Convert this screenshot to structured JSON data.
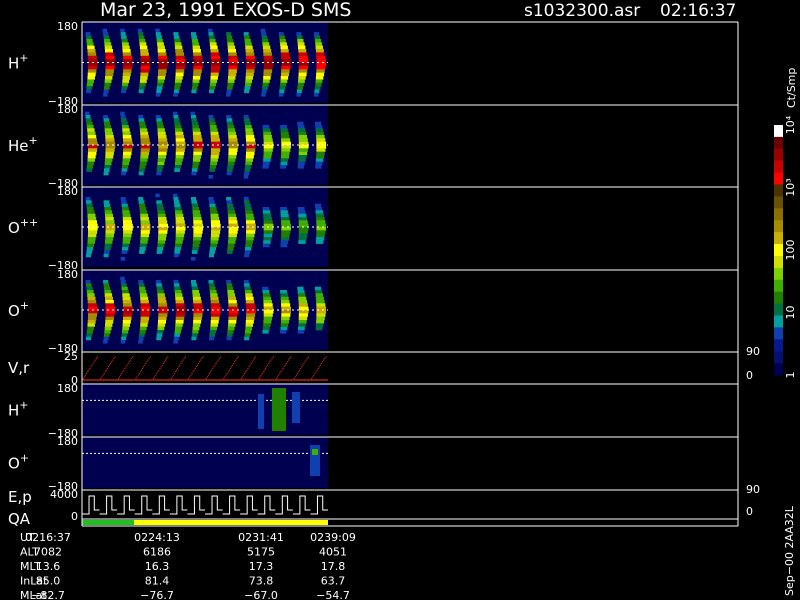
{
  "header": {
    "title": "Mar 23, 1991   EXOS-D SMS",
    "file": "s1032300.asr",
    "time": "02:16:37"
  },
  "colorbar": {
    "unit_label": "Ct/Smp",
    "tick_labels": [
      "10⁴",
      "10³",
      "100",
      "10",
      "1"
    ],
    "tick_values": [
      10000,
      1000,
      100,
      10,
      1
    ],
    "colors": [
      "#ffffff",
      "#6a0000",
      "#9a0000",
      "#c80000",
      "#ff0000",
      "#4a3300",
      "#6a5200",
      "#8a7000",
      "#a58c00",
      "#c8b000",
      "#ffff00",
      "#d0e000",
      "#80d000",
      "#40b000",
      "#208000",
      "#007040",
      "#00a0a0",
      "#1040b0",
      "#081890",
      "#061070",
      "#000050"
    ]
  },
  "panels": [
    {
      "label": "H",
      "sup": "+",
      "ymax": "180",
      "ymin": "−180"
    },
    {
      "label": "He",
      "sup": "+",
      "ymax": "180",
      "ymin": "−180"
    },
    {
      "label": "O",
      "sup": "++",
      "ymax": "180",
      "ymin": "−180"
    },
    {
      "label": "O",
      "sup": "+",
      "ymax": "180",
      "ymin": "−180"
    },
    {
      "label": "V,r",
      "ymax": "25",
      "ymin": "0",
      "right_top": "90",
      "right_bottom": "0"
    },
    {
      "label": "H",
      "sup": "+",
      "ymax": "180",
      "ymin": "−180"
    },
    {
      "label": "O",
      "sup": "+",
      "ymax": "180",
      "ymin": "−180"
    },
    {
      "label": "E,p",
      "ymax": "4000",
      "ymin": "0",
      "right_top": "90",
      "right_bottom": "0"
    },
    {
      "label": "QA"
    }
  ],
  "chart_data": {
    "type": "heatmap",
    "title": "Mar 23, 1991   EXOS-D SMS",
    "time_range": [
      "02:16:37",
      "02:39:09"
    ],
    "x_tick_labels": [
      "0216:37",
      "0224:13",
      "0231:41",
      "0239:09"
    ],
    "series": [
      {
        "name": "H+",
        "ylim": [
          -180,
          180
        ]
      },
      {
        "name": "He+",
        "ylim": [
          -180,
          180
        ]
      },
      {
        "name": "O++",
        "ylim": [
          -180,
          180
        ]
      },
      {
        "name": "O+",
        "ylim": [
          -180,
          180
        ]
      },
      {
        "name": "V,r",
        "ylim": [
          0,
          25
        ],
        "right_ylim": [
          0,
          90
        ]
      },
      {
        "name": "H+",
        "ylim": [
          -180,
          180
        ]
      },
      {
        "name": "O+",
        "ylim": [
          -180,
          180
        ]
      },
      {
        "name": "E,p",
        "ylim": [
          0,
          4000
        ],
        "right_ylim": [
          0,
          90
        ]
      },
      {
        "name": "QA"
      }
    ],
    "colorbar": {
      "label": "Ct/Smp",
      "scale": "log",
      "range": [
        1,
        10000
      ]
    },
    "sweeps": 14
  },
  "footer": {
    "rows": [
      {
        "label": "UT",
        "values": [
          "0216:37",
          "0224:13",
          "0231:41",
          "0239:09"
        ]
      },
      {
        "label": "ALT",
        "values": [
          "7082",
          "6186",
          "5175",
          "4051"
        ]
      },
      {
        "label": "MLT",
        "values": [
          "13.6",
          "16.3",
          "17.3",
          "17.8"
        ]
      },
      {
        "label": "InLat",
        "values": [
          "85.0",
          "81.4",
          "73.8",
          "63.7"
        ]
      },
      {
        "label": "MLat",
        "values": [
          "−82.7",
          "−76.7",
          "−67.0",
          "−54.7"
        ]
      }
    ],
    "side_label": "Sep−00  2AA32L"
  }
}
